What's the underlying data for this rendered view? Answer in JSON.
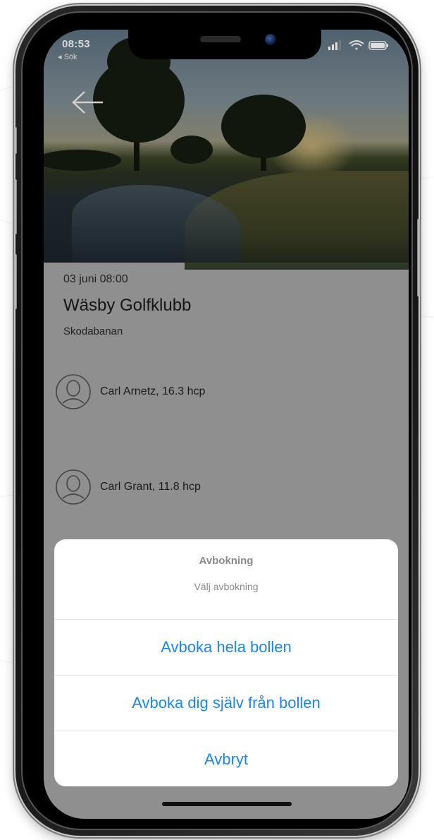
{
  "status_bar": {
    "time": "08:53",
    "back_app": "◂ Sök"
  },
  "booking": {
    "date": "03 juni 08:00",
    "club": "Wäsby Golfklubb",
    "course": "Skodabanan"
  },
  "players": [
    {
      "name": "Carl Arnetz, 16.3 hcp"
    },
    {
      "name": "Carl Grant, 11.8 hcp"
    }
  ],
  "action_sheet": {
    "title": "Avbokning",
    "message": "Välj avbokning",
    "actions": [
      "Avboka hela bollen",
      "Avboka dig själv från bollen",
      "Avbryt"
    ]
  },
  "colors": {
    "accent": "#1a86f0",
    "overlay": "#8f8f8f",
    "sheet_muted_text": "#8a8a8e"
  },
  "icons": {
    "back": "arrow-left-icon",
    "avatar": "user-avatar-icon",
    "signal": "signal-icon",
    "wifi": "wifi-icon",
    "battery": "battery-icon"
  }
}
